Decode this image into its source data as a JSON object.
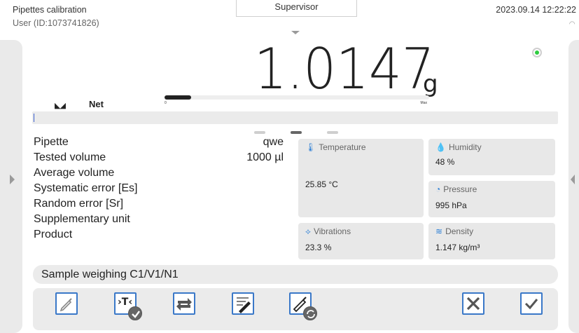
{
  "header": {
    "title": "Pipettes calibration",
    "user": "User (ID:1073741826)",
    "role": "Supervisor",
    "datetime": "2023.09.14 12:22:22"
  },
  "display": {
    "weight": "1.0147",
    "unit": "g",
    "net_label": "Net",
    "range_min_label": "0",
    "range_max_label": "Max",
    "range_fraction": 0.1,
    "stability_color": "#2ecc40"
  },
  "info": [
    {
      "label": "Pipette",
      "value": "qwe"
    },
    {
      "label": "Tested volume",
      "value": "1000 µl"
    },
    {
      "label": "Average volume",
      "value": ""
    },
    {
      "label": "Systematic error [Es]",
      "value": ""
    },
    {
      "label": "Random error [Sr]",
      "value": ""
    },
    {
      "label": "Supplementary unit",
      "value": ""
    },
    {
      "label": "Product",
      "value": ""
    }
  ],
  "environment": {
    "temperature": {
      "label": "Temperature",
      "value": "25.85 °C",
      "icon": "thermometer-icon"
    },
    "humidity": {
      "label": "Humidity",
      "value": "48 %",
      "icon": "humidity-icon"
    },
    "pressure": {
      "label": "Pressure",
      "value": "995 hPa",
      "icon": "pressure-icon"
    },
    "vibrations": {
      "label": "Vibrations",
      "value": "23.3 %",
      "icon": "vibrations-icon"
    },
    "density": {
      "label": "Density",
      "value": "1.147 kg/m³",
      "icon": "wind-density-icon"
    }
  },
  "sample": {
    "text": "Sample weighing  C1/V1/N1"
  },
  "toolbar": {
    "buttons": [
      "pipette-icon",
      "tare-confirm-icon",
      "swap-icon",
      "report-edit-icon",
      "pipette-refresh-icon",
      "cancel-icon",
      "confirm-icon"
    ]
  },
  "colors": {
    "accent": "#3a78c8",
    "tile_icon": "#2f80d6"
  }
}
